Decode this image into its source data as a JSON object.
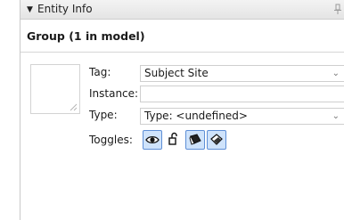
{
  "panel": {
    "title": "Entity Info",
    "collapse_glyph": "▼"
  },
  "group_heading": "Group (1 in model)",
  "fields": {
    "tag_label": "Tag:",
    "tag_value": "Subject Site",
    "instance_label": "Instance:",
    "instance_value": "",
    "type_label": "Type:",
    "type_value": "Type: <undefined>",
    "toggles_label": "Toggles:"
  },
  "toggles": [
    {
      "icon": "eye-icon",
      "state": "on"
    },
    {
      "icon": "unlock-icon",
      "state": "off"
    },
    {
      "icon": "cast-shadows-icon",
      "state": "on"
    },
    {
      "icon": "receive-shadows-icon",
      "state": "on"
    }
  ],
  "colors": {
    "toggle_active_bg": "#cfe3fb",
    "toggle_active_border": "#5e8fd6"
  }
}
